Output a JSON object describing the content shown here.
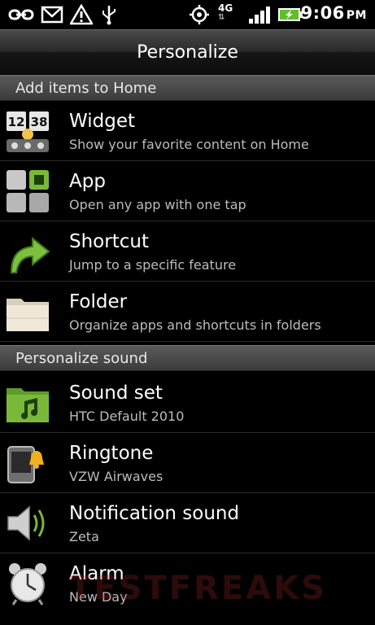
{
  "status_bar": {
    "time": "9:06",
    "ampm": "PM",
    "network": "4G",
    "icons": [
      "usb-link-icon",
      "gmail-icon",
      "warning-icon",
      "usb-icon",
      "gps-icon",
      "network-4g-icon",
      "signal-icon",
      "battery-charging-icon"
    ]
  },
  "title": "Personalize",
  "sections": {
    "home": "Add items to Home",
    "sound": "Personalize sound"
  },
  "home_items": [
    {
      "label": "Widget",
      "desc": "Show your favorite content on Home",
      "icon": "widget-clock-icon"
    },
    {
      "label": "App",
      "desc": "Open any app with one tap",
      "icon": "app-grid-icon"
    },
    {
      "label": "Shortcut",
      "desc": "Jump to a specific feature",
      "icon": "shortcut-arrow-icon"
    },
    {
      "label": "Folder",
      "desc": "Organize apps and shortcuts in folders",
      "icon": "folder-icon"
    }
  ],
  "sound_items": [
    {
      "label": "Sound set",
      "desc": "HTC Default 2010",
      "icon": "music-folder-icon"
    },
    {
      "label": "Ringtone",
      "desc": "VZW Airwaves",
      "icon": "ringtone-bell-icon"
    },
    {
      "label": "Notification sound",
      "desc": "Zeta",
      "icon": "speaker-icon"
    },
    {
      "label": "Alarm",
      "desc": "New Day",
      "icon": "alarm-clock-icon"
    }
  ],
  "watermark": "TESTFREAKS",
  "colors": {
    "background": "#000000",
    "section_header": "#4a4a4a",
    "accent_green": "#7ab83a"
  }
}
